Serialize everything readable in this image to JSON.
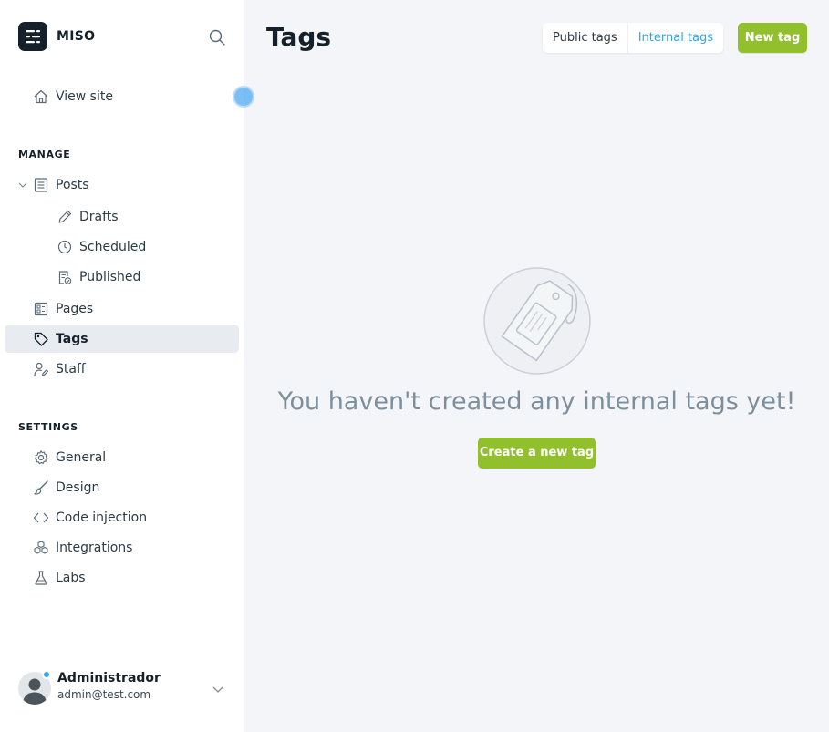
{
  "brand": {
    "name": "MISO"
  },
  "nav": {
    "view_site": "View site",
    "manage_title": "MANAGE",
    "posts": "Posts",
    "drafts": "Drafts",
    "scheduled": "Scheduled",
    "published": "Published",
    "pages": "Pages",
    "tags": "Tags",
    "staff": "Staff",
    "settings_title": "SETTINGS",
    "general": "General",
    "design": "Design",
    "code_injection": "Code injection",
    "integrations": "Integrations",
    "labs": "Labs"
  },
  "user": {
    "name": "Administrador",
    "email": "admin@test.com"
  },
  "main": {
    "title": "Tags",
    "tabs": [
      "Public tags",
      "Internal tags"
    ],
    "active_tab": "Internal tags",
    "new_tag": "New tag",
    "empty_message": "You haven't created any internal tags yet!",
    "create_button": "Create a new tag"
  },
  "colors": {
    "accent_green": "#92c02c",
    "accent_blue": "#30a6e8",
    "active_nav_bg": "#e8ebf0"
  }
}
